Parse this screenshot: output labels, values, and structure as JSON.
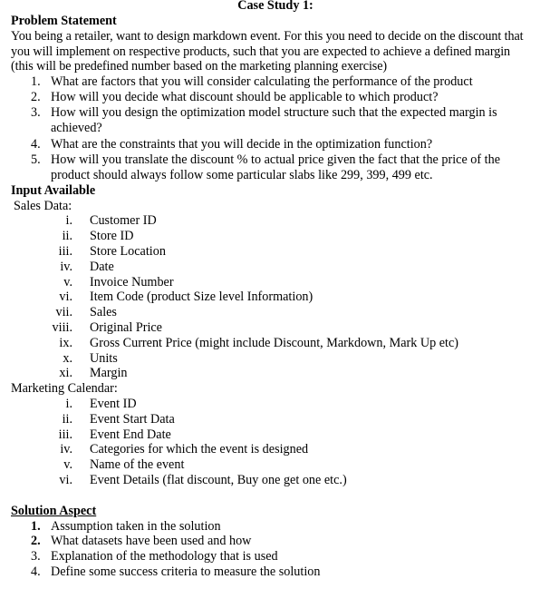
{
  "title": "Case Study 1:",
  "problem": {
    "heading": "Problem Statement",
    "intro": "You being a retailer, want to design markdown event. For this you need to decide on the discount that you will implement on respective products, such that you are expected to achieve a defined margin (this will be predefined number based on the marketing planning exercise)",
    "questions": [
      {
        "num": "1.",
        "text": "What are factors that you will consider calculating the performance of the product"
      },
      {
        "num": "2.",
        "text": "How will you decide what discount should be applicable to which product?"
      },
      {
        "num": "3.",
        "text": "How will you design the optimization model structure such that the expected margin is achieved?"
      },
      {
        "num": "4.",
        "text": "What are the constraints that you will decide in the optimization function?"
      },
      {
        "num": "5.",
        "text": "How will you translate the discount % to actual price given the fact that the price of the product should always follow some particular slabs like 299, 399, 499 etc."
      }
    ]
  },
  "input": {
    "heading": "Input Available",
    "sales": {
      "label": "Sales Data:",
      "items": [
        {
          "num": "i.",
          "text": "Customer ID"
        },
        {
          "num": "ii.",
          "text": "Store ID"
        },
        {
          "num": "iii.",
          "text": "Store Location"
        },
        {
          "num": "iv.",
          "text": "Date"
        },
        {
          "num": "v.",
          "text": "Invoice Number"
        },
        {
          "num": "vi.",
          "text": "Item Code (product Size level Information)"
        },
        {
          "num": "vii.",
          "text": "Sales"
        },
        {
          "num": "viii.",
          "text": "Original Price"
        },
        {
          "num": "ix.",
          "text": "Gross Current Price (might include Discount, Markdown, Mark Up etc)"
        },
        {
          "num": "x.",
          "text": "Units"
        },
        {
          "num": "xi.",
          "text": "Margin"
        }
      ]
    },
    "calendar": {
      "label": "Marketing Calendar:",
      "items": [
        {
          "num": "i.",
          "text": "Event ID"
        },
        {
          "num": "ii.",
          "text": "Event Start Data"
        },
        {
          "num": "iii.",
          "text": "Event End Date"
        },
        {
          "num": "iv.",
          "text": "Categories for which the event is designed"
        },
        {
          "num": "v.",
          "text": "Name of the event"
        },
        {
          "num": "vi.",
          "text": "Event Details (flat discount, Buy one get one etc.)"
        }
      ]
    }
  },
  "solution": {
    "heading": "Solution Aspect",
    "items": [
      {
        "num": "1.",
        "text": "Assumption taken in the solution"
      },
      {
        "num": "2.",
        "text": "What datasets have been used and how"
      },
      {
        "num": "3.",
        "text": "Explanation of the methodology that is used"
      },
      {
        "num": "4.",
        "text": "Define some success criteria to measure the solution"
      }
    ]
  }
}
